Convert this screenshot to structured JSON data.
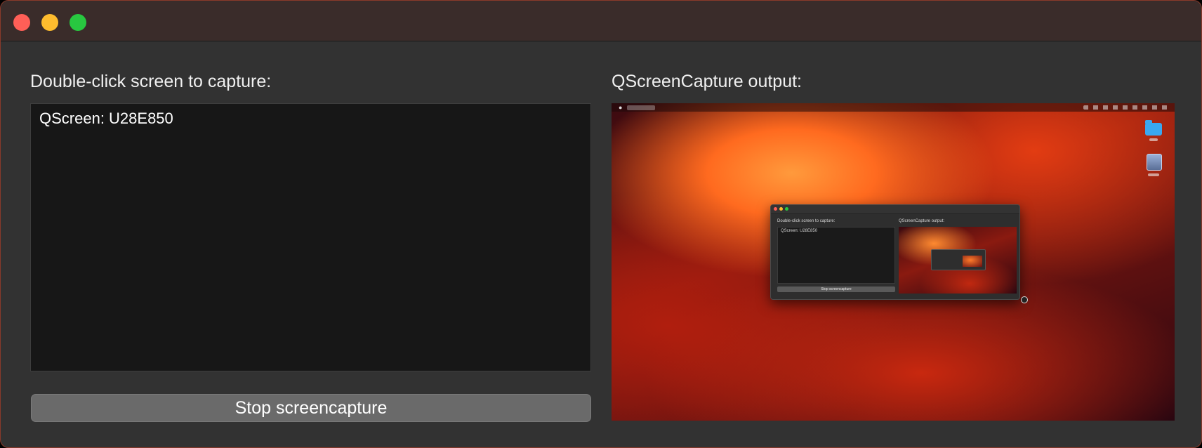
{
  "window": {
    "controls": [
      "close",
      "minimize",
      "maximize"
    ]
  },
  "left_panel": {
    "label": "Double-click screen to capture:",
    "screens": [
      "QScreen: U28E850"
    ]
  },
  "right_panel": {
    "label": "QScreenCapture output:"
  },
  "button": {
    "label": "Stop screencapture"
  },
  "preview": {
    "mini_left_label": "Double-click screen to capture:",
    "mini_right_label": "QScreenCapture output:",
    "mini_screen_item": "QScreen: U28E850",
    "mini_button_label": "Stop screencapture",
    "icons": [
      "apple-icon",
      "folder-icon",
      "drive-icon"
    ]
  },
  "colors": {
    "window_bg": "#323232",
    "list_bg": "#171717",
    "button_bg": "#6a6a6a",
    "close": "#fe5f57",
    "minimize": "#febc2e",
    "maximize": "#28c840"
  }
}
